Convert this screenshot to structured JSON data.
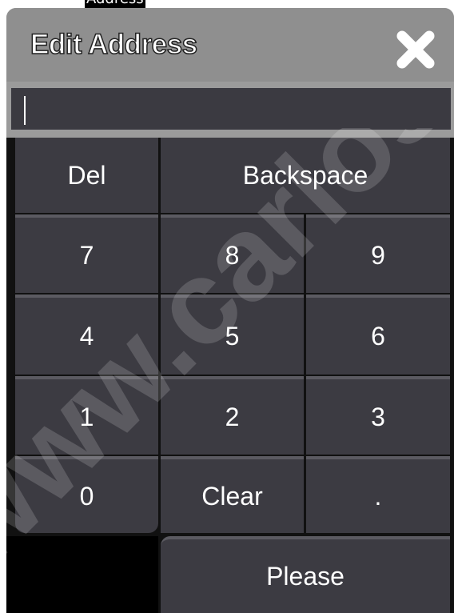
{
  "header_snippet": "Address",
  "dialog": {
    "title": "Edit Address",
    "input_value": ""
  },
  "keys": {
    "del": "Del",
    "backspace": "Backspace",
    "k7": "7",
    "k8": "8",
    "k9": "9",
    "k4": "4",
    "k5": "5",
    "k6": "6",
    "k1": "1",
    "k2": "2",
    "k3": "3",
    "k0": "0",
    "clear": "Clear",
    "dot": ".",
    "please": "Please"
  },
  "watermark": "www.carlosm",
  "colors": {
    "dialog_frame": "#8f8f8f",
    "key_face": "#3c3b42",
    "key_separator": "#111111",
    "key_text": "#ffffff"
  },
  "icons": {
    "close": "close-x-icon"
  }
}
